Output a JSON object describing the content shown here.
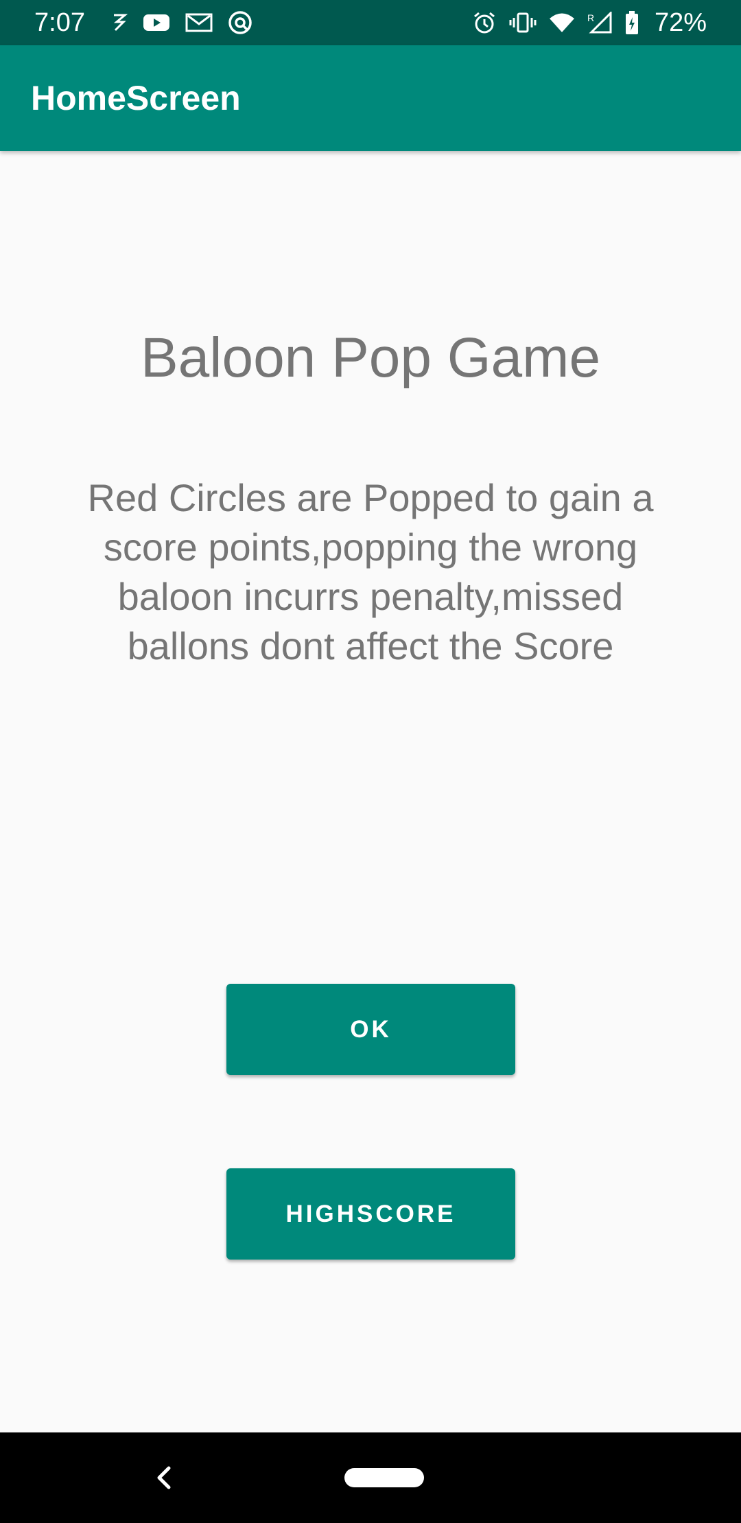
{
  "status_bar": {
    "time": "7:07",
    "battery": "72%",
    "left_icons": [
      "now-icon",
      "youtube-icon",
      "gmail-icon",
      "app-icon"
    ],
    "right_icons": [
      "alarm-icon",
      "vibrate-icon",
      "wifi-icon",
      "signal-icon",
      "battery-icon"
    ]
  },
  "app_bar": {
    "title": "HomeScreen"
  },
  "main": {
    "title": "Baloon Pop Game",
    "description": "Red Circles are Popped to gain a score points,popping the wrong baloon incurrs penalty,missed ballons dont affect the Score"
  },
  "buttons": {
    "ok_label": "OK",
    "highscore_label": "HIGHSCORE"
  },
  "colors": {
    "primary": "#00897b",
    "primary_dark": "#00594f",
    "text_secondary": "#757575",
    "background": "#fafafa"
  }
}
